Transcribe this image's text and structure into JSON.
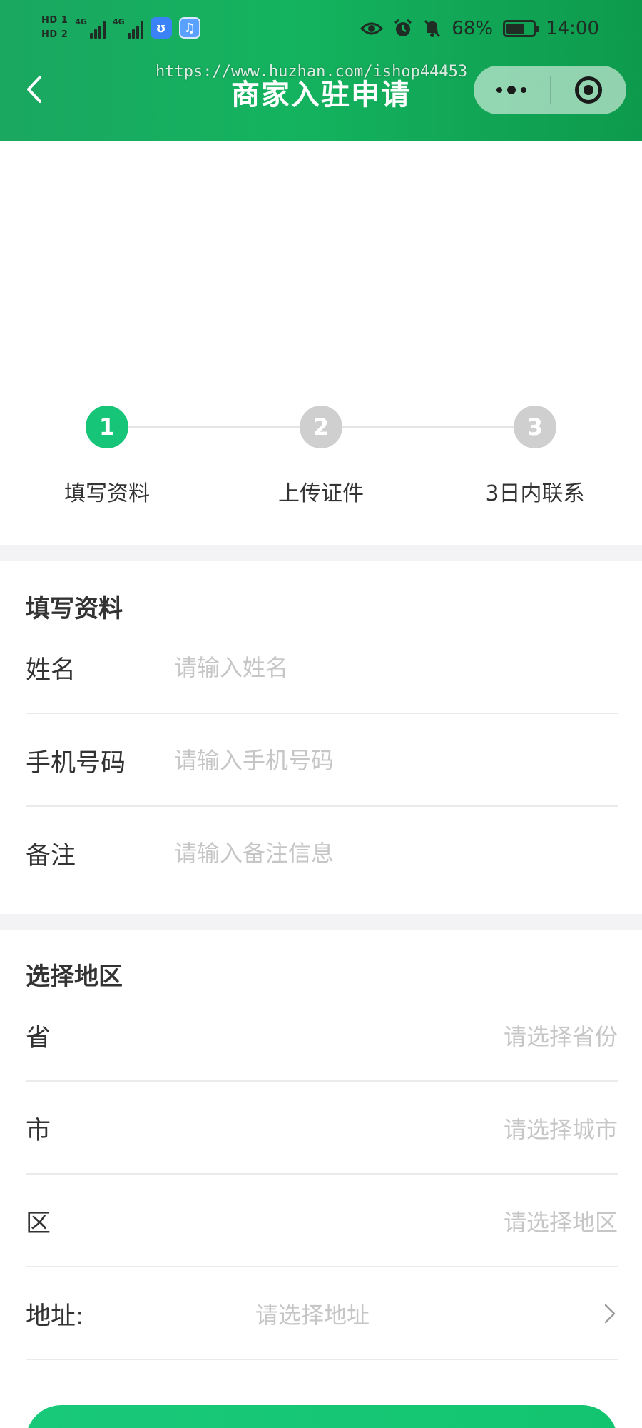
{
  "status_bar": {
    "hd1": "HD 1",
    "hd2": "HD 2",
    "net1": "4G",
    "net2": "4G",
    "battery_text": "68%",
    "battery_level": 0.68,
    "time": "14:00",
    "icons": [
      "eye-icon",
      "alarm-icon",
      "mute-icon"
    ]
  },
  "header": {
    "title": "商家入驻申请",
    "watermark": "https://www.huzhan.com/ishop44453",
    "colors": {
      "start": "#1aa760",
      "end": "#0e9a4d"
    }
  },
  "steps": [
    {
      "number": "1",
      "label": "填写资料",
      "active": true
    },
    {
      "number": "2",
      "label": "上传证件",
      "active": false
    },
    {
      "number": "3",
      "label": "3日内联系",
      "active": false
    }
  ],
  "info_section": {
    "title": "填写资料",
    "fields": [
      {
        "label": "姓名",
        "placeholder": "请输入姓名"
      },
      {
        "label": "手机号码",
        "placeholder": "请输入手机号码"
      },
      {
        "label": "备注",
        "placeholder": "请输入备注信息"
      }
    ]
  },
  "region_section": {
    "title": "选择地区",
    "province": {
      "label": "省",
      "placeholder": "请选择省份"
    },
    "city": {
      "label": "市",
      "placeholder": "请选择城市"
    },
    "district": {
      "label": "区",
      "placeholder": "请选择地区"
    },
    "address": {
      "label": "地址:",
      "placeholder": "请选择地址"
    }
  },
  "accent_color": "#16c578"
}
